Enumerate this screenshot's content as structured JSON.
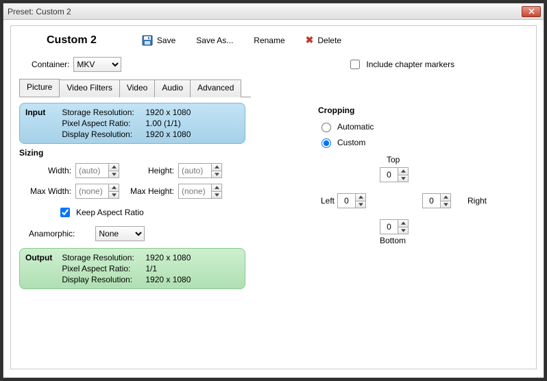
{
  "window": {
    "title": "Preset: Custom 2"
  },
  "toolbar": {
    "preset_name": "Custom 2",
    "save": "Save",
    "save_as": "Save As...",
    "rename": "Rename",
    "delete": "Delete"
  },
  "container_row": {
    "label": "Container:",
    "value": "MKV",
    "chapter_markers": "Include chapter markers",
    "chapter_checked": false
  },
  "tabs": {
    "items": [
      "Picture",
      "Video Filters",
      "Video",
      "Audio",
      "Advanced"
    ],
    "active": 0
  },
  "input_box": {
    "header": "Input",
    "rows": {
      "storage_label": "Storage Resolution:",
      "storage_value": "1920 x 1080",
      "par_label": "Pixel Aspect Ratio:",
      "par_value": "1.00 (1/1)",
      "display_label": "Display Resolution:",
      "display_value": "1920 x 1080"
    }
  },
  "sizing": {
    "header": "Sizing",
    "width_label": "Width:",
    "width_value": "(auto)",
    "height_label": "Height:",
    "height_value": "(auto)",
    "max_width_label": "Max Width:",
    "max_width_value": "(none)",
    "max_height_label": "Max Height:",
    "max_height_value": "(none)",
    "keep_ar": "Keep Aspect Ratio",
    "keep_ar_checked": true,
    "anamorphic_label": "Anamorphic:",
    "anamorphic_value": "None"
  },
  "output_box": {
    "header": "Output",
    "rows": {
      "storage_label": "Storage Resolution:",
      "storage_value": "1920 x 1080",
      "par_label": "Pixel Aspect Ratio:",
      "par_value": "1/1",
      "display_label": "Display Resolution:",
      "display_value": "1920 x 1080"
    }
  },
  "cropping": {
    "header": "Cropping",
    "automatic": "Automatic",
    "custom": "Custom",
    "mode": "custom",
    "top_label": "Top",
    "bottom_label": "Bottom",
    "left_label": "Left",
    "right_label": "Right",
    "top": "0",
    "bottom": "0",
    "left": "0",
    "right": "0"
  }
}
